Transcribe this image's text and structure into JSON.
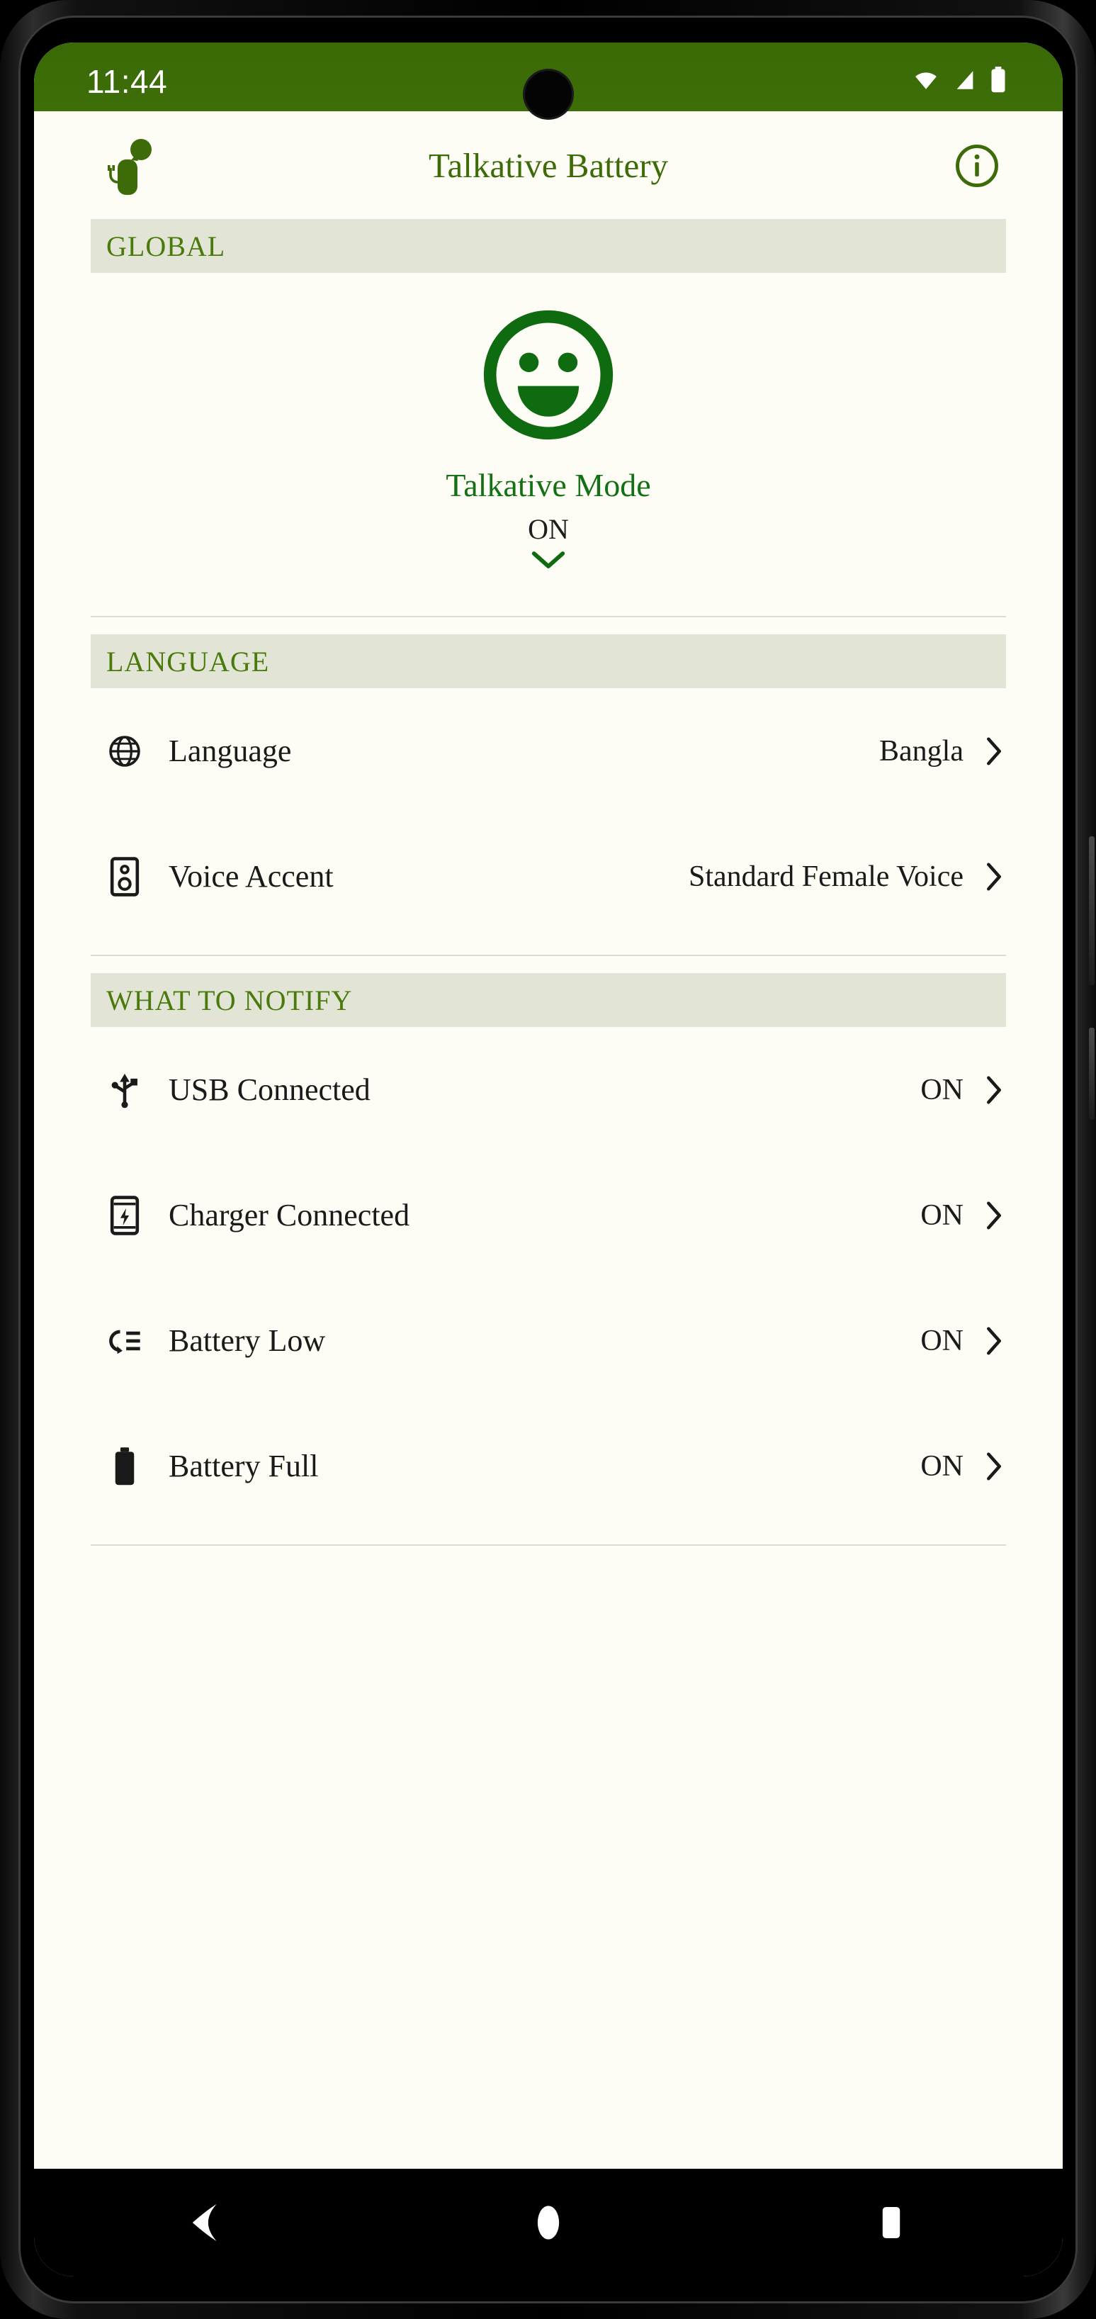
{
  "status_bar": {
    "time": "11:44",
    "icons": [
      "wifi-icon",
      "signal-icon",
      "battery-icon"
    ]
  },
  "app_bar": {
    "title": "Talkative Battery",
    "left_icon": "battery-speech-bubble-icon",
    "right_icon": "info-icon"
  },
  "colors": {
    "primary_green": "#3d6b07",
    "accent_green": "#147014",
    "status_bar_green": "#3b6b07",
    "section_band": "#e2e5d5",
    "page_bg": "#fdfcf5",
    "text_dark": "#1a1a1a"
  },
  "sections": [
    {
      "header": "GLOBAL",
      "card": {
        "icon": "smiley-face-icon",
        "label": "Talkative Mode",
        "state": "ON",
        "chevron": "chevron-down-icon"
      }
    },
    {
      "header": "LANGUAGE",
      "rows": [
        {
          "icon": "globe-icon",
          "label": "Language",
          "value": "Bangla",
          "chevron": "chevron-right-icon"
        },
        {
          "icon": "speaker-icon",
          "label": "Voice Accent",
          "value": "Standard Female Voice",
          "chevron": "chevron-right-icon"
        }
      ]
    },
    {
      "header": "WHAT TO NOTIFY",
      "rows": [
        {
          "icon": "usb-icon",
          "label": "USB Connected",
          "value": "ON",
          "chevron": "chevron-right-icon"
        },
        {
          "icon": "charging-icon",
          "label": "Charger Connected",
          "value": "ON",
          "chevron": "chevron-right-icon"
        },
        {
          "icon": "battery-low-icon",
          "label": "Battery Low",
          "value": "ON",
          "chevron": "chevron-right-icon"
        },
        {
          "icon": "battery-full-icon",
          "label": "Battery Full",
          "value": "ON",
          "chevron": "chevron-right-icon"
        }
      ]
    }
  ],
  "nav_bar": {
    "back": "back-triangle-icon",
    "home": "home-circle-icon",
    "recents": "recents-square-icon"
  }
}
